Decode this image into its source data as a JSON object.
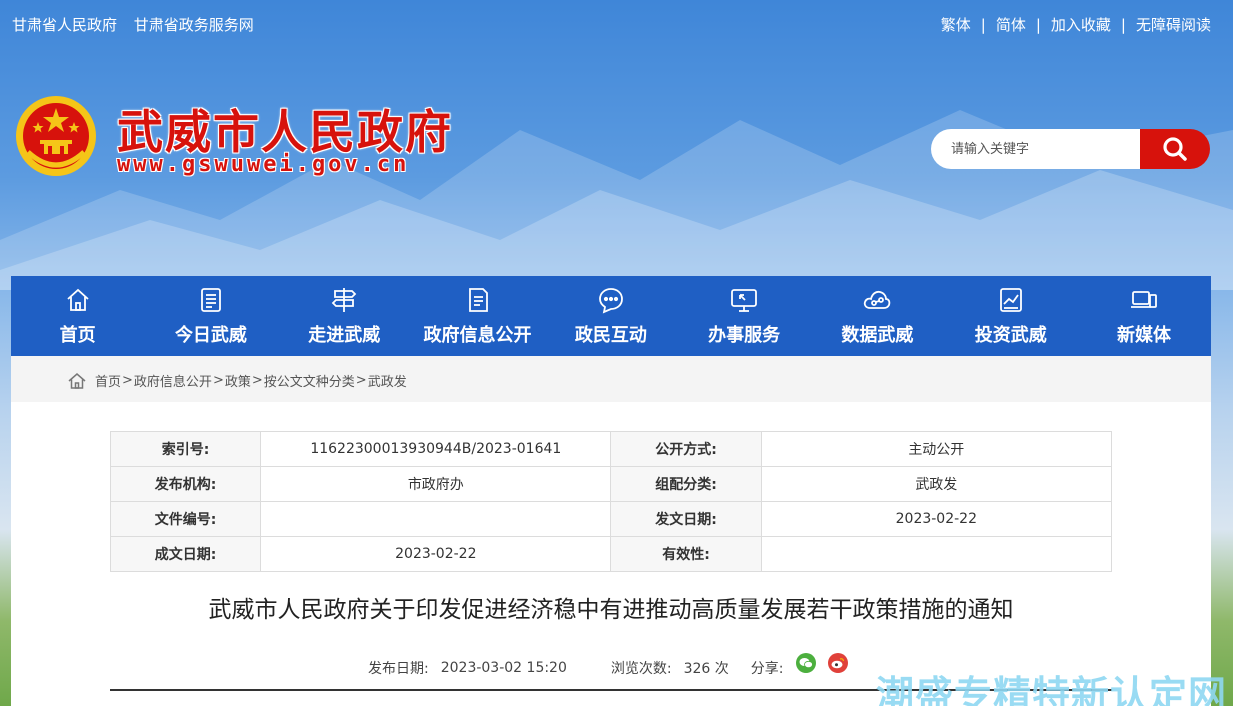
{
  "topbar": {
    "left_links": [
      "甘肃省人民政府",
      "甘肃省政务服务网"
    ],
    "right_links": [
      "繁体",
      "简体",
      "加入收藏",
      "无障碍阅读"
    ],
    "separator": "|"
  },
  "header": {
    "title": "武威市人民政府",
    "url": "www.gswuwei.gov.cn",
    "emblem_icon": "national-emblem-icon"
  },
  "search": {
    "placeholder": "请输入关键字",
    "button_icon": "search-icon",
    "accent": "#d7120c"
  },
  "nav": {
    "items": [
      {
        "label": "首页",
        "icon": "home-icon"
      },
      {
        "label": "今日武威",
        "icon": "newspaper-icon"
      },
      {
        "label": "走进武威",
        "icon": "signpost-icon"
      },
      {
        "label": "政府信息公开",
        "icon": "document-icon"
      },
      {
        "label": "政民互动",
        "icon": "chat-icon"
      },
      {
        "label": "办事服务",
        "icon": "monitor-icon"
      },
      {
        "label": "数据武威",
        "icon": "cloud-data-icon"
      },
      {
        "label": "投资武威",
        "icon": "chart-icon"
      },
      {
        "label": "新媒体",
        "icon": "devices-icon"
      }
    ],
    "color": "#1f5fc4"
  },
  "breadcrumb": {
    "items": [
      "首页",
      "政府信息公开",
      "政策",
      "按公文文种分类",
      "武政发"
    ],
    "separator": ">"
  },
  "meta_table": {
    "rows": [
      [
        {
          "label": "索引号:",
          "value": "11622300013930944B/2023-01641"
        },
        {
          "label": "公开方式:",
          "value": "主动公开"
        }
      ],
      [
        {
          "label": "发布机构:",
          "value": "市政府办"
        },
        {
          "label": "组配分类:",
          "value": "武政发"
        }
      ],
      [
        {
          "label": "文件编号:",
          "value": ""
        },
        {
          "label": "发文日期:",
          "value": "2023-02-22"
        }
      ],
      [
        {
          "label": "成文日期:",
          "value": "2023-02-22"
        },
        {
          "label": "有效性:",
          "value": ""
        }
      ]
    ]
  },
  "document": {
    "title": "武威市人民政府关于印发促进经济稳中有进推动高质量发展若干政策措施的通知",
    "publish_label": "发布日期:",
    "publish_date": "2023-03-02 15:20",
    "views_label": "浏览次数:",
    "views": "326 次",
    "share_label": "分享:",
    "share_icons": [
      "wechat-icon",
      "weibo-icon"
    ]
  },
  "watermark": "潮盛专精特新认定网"
}
